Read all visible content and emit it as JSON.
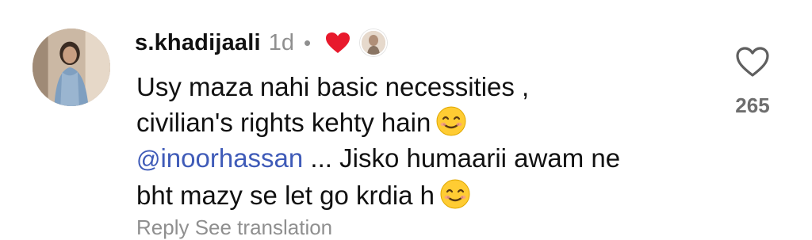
{
  "comment": {
    "username": "s.khadijaali",
    "time": "1d",
    "separator": "•",
    "liked_by_author_icon": "heart-filled-red-icon",
    "lines": [
      "Usy maza nahi basic necessities ,",
      "civilian's rights kehty hain"
    ],
    "mention_symbol": "@",
    "mention_handle": "inoorhassan",
    "line3_rest": " ... Jisko humaarii awam ne",
    "line4": "bht mazy se let go krdia h",
    "emoji": "smiling-face-with-smiling-eyes"
  },
  "like": {
    "icon": "heart-outline-icon",
    "count": "265"
  },
  "footer": {
    "text": "Reply   See translation"
  },
  "colors": {
    "mention": "#3f5bb8",
    "meta": "#8f8f8f",
    "heart": "#e8192c"
  }
}
